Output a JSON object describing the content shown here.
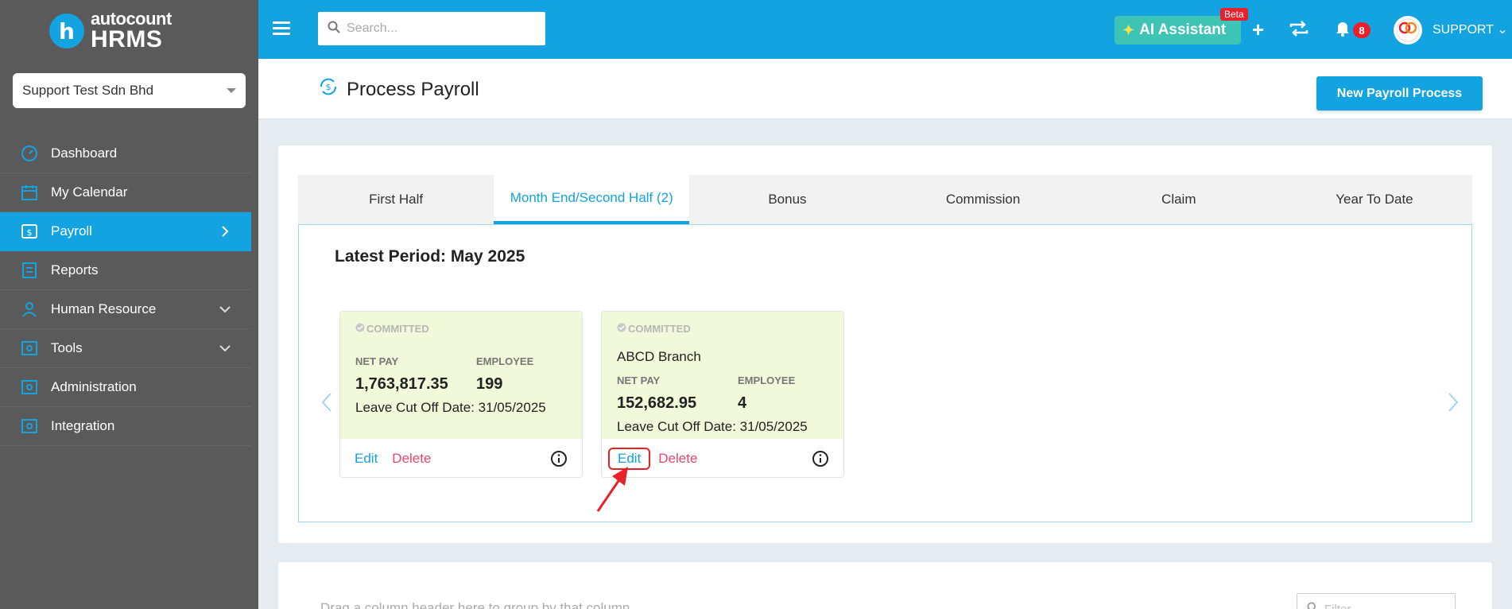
{
  "brand": {
    "small": "autocount",
    "big": "HRMS"
  },
  "company": {
    "name": "Support Test Sdn Bhd"
  },
  "sidebar": {
    "items": [
      {
        "label": "Dashboard",
        "icon": "dashboard-icon"
      },
      {
        "label": "My Calendar",
        "icon": "calendar-icon"
      },
      {
        "label": "Payroll",
        "icon": "payroll-icon",
        "active": true
      },
      {
        "label": "Reports",
        "icon": "reports-icon"
      },
      {
        "label": "Human Resource",
        "icon": "human-resource-icon"
      },
      {
        "label": "Tools",
        "icon": "tools-icon"
      },
      {
        "label": "Administration",
        "icon": "administration-icon"
      },
      {
        "label": "Integration",
        "icon": "integration-icon"
      }
    ]
  },
  "topbar": {
    "search_placeholder": "Search...",
    "ai_label": "AI Assistant",
    "beta_label": "Beta",
    "notification_count": "8",
    "user_name": "SUPPORT"
  },
  "page": {
    "title": "Process Payroll",
    "new_button": "New Payroll Process"
  },
  "tabs": [
    {
      "label": "First Half"
    },
    {
      "label": "Month End/Second Half (2)",
      "active": true
    },
    {
      "label": "Bonus"
    },
    {
      "label": "Commission"
    },
    {
      "label": "Claim"
    },
    {
      "label": "Year To Date"
    }
  ],
  "period": {
    "label": "Latest Period: May 2025"
  },
  "payroll_cards": [
    {
      "status": "COMMITTED",
      "branch": "",
      "net_pay_label": "NET PAY",
      "net_pay": "1,763,817.35",
      "employee_label": "EMPLOYEE",
      "employee": "199",
      "cutoff": "Leave Cut Off Date: 31/05/2025",
      "edit": "Edit",
      "delete": "Delete"
    },
    {
      "status": "COMMITTED",
      "branch": "ABCD Branch",
      "net_pay_label": "NET PAY",
      "net_pay": "152,682.95",
      "employee_label": "EMPLOYEE",
      "employee": "4",
      "cutoff": "Leave Cut Off Date: 31/05/2025",
      "edit": "Edit",
      "delete": "Delete"
    }
  ],
  "grid": {
    "drag_hint": "Drag a column header here to group by that column",
    "filter_placeholder": "Filter..."
  },
  "colors": {
    "accent": "#12a3e0",
    "sidebar": "#5a5a5a",
    "card_bg": "#f0f9d9",
    "delete": "#e3486b",
    "highlight": "#e8202a"
  }
}
